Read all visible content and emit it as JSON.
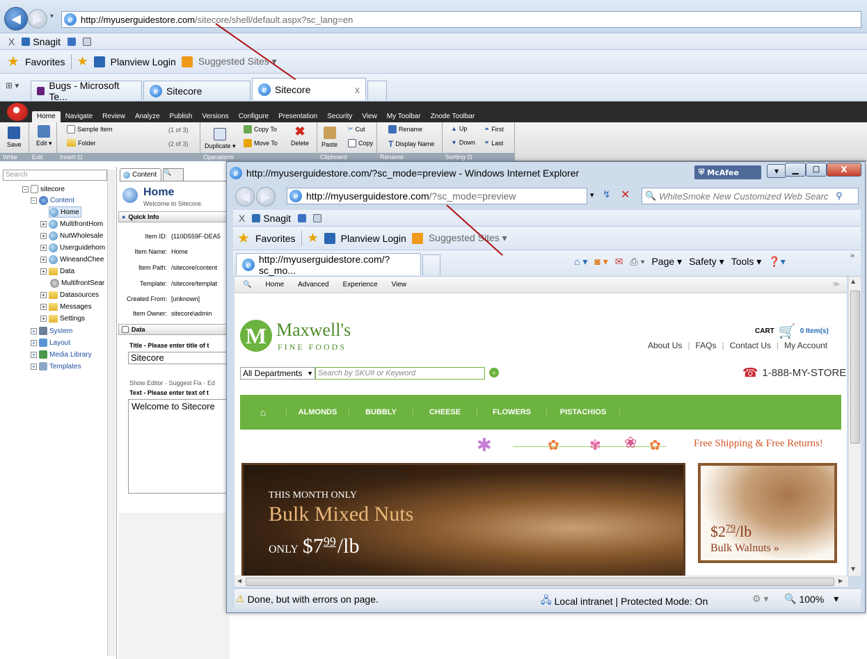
{
  "outer_ie": {
    "url_domain": "http://myuserguidestore.com",
    "url_path": "/sitecore/shell/default.aspx?sc_lang=en",
    "links_bar": {
      "close": "X",
      "snagit": "Snagit"
    },
    "favorites_bar": {
      "favorites": "Favorites",
      "planview": "Planview Login",
      "suggested": "Suggested Sites ▾"
    },
    "tabs": [
      {
        "label": "Bugs - Microsoft Te..."
      },
      {
        "label": "Sitecore"
      },
      {
        "label": "Sitecore",
        "close": "x"
      }
    ]
  },
  "sitecore": {
    "tabs": [
      "Home",
      "Navigate",
      "Review",
      "Analyze",
      "Publish",
      "Versions",
      "Configure",
      "Presentation",
      "Security",
      "View",
      "My Toolbar",
      "Znode Toolbar"
    ],
    "ribbon": {
      "save": "Save",
      "edit": "Edit",
      "edit_dd": "Edit ▾",
      "sample_item": "Sample Item",
      "sample_count": "(1 of 3)",
      "folder": "Folder",
      "folder_count": "(2 of 3)",
      "duplicate": "Duplicate ▾",
      "copy_to": "Copy To",
      "move_to": "Move To",
      "delete": "Delete",
      "paste": "Paste",
      "cut": "Cut",
      "copy": "Copy",
      "rename": "Rename",
      "display_name": "Display Name",
      "up": "Up",
      "down": "Down",
      "first": "First",
      "last": "Last",
      "groups": {
        "write": "Write",
        "edit": "Edit",
        "insert": "Insert ⊡",
        "operations": "Operations",
        "clipboard": "Clipboard",
        "rename": "Rename",
        "sorting": "Sorting ⊡"
      }
    },
    "search_placeholder": "Search",
    "tree": [
      {
        "label": "sitecore"
      },
      {
        "label": "Content"
      },
      {
        "label": "Home"
      },
      {
        "label": "MultifrontHom"
      },
      {
        "label": "NutWholesale"
      },
      {
        "label": "Userguidehom"
      },
      {
        "label": "WineandChee"
      },
      {
        "label": "Data"
      },
      {
        "label": "MultifrontSear"
      },
      {
        "label": "Datasources"
      },
      {
        "label": "Messages"
      },
      {
        "label": "Settings"
      },
      {
        "label": "System"
      },
      {
        "label": "Layout"
      },
      {
        "label": "Media Library"
      },
      {
        "label": "Templates"
      }
    ],
    "content_tab": "Content",
    "item_title": "Home",
    "item_subtitle": "Welcome to Sitecore.",
    "quick_info": "Quick Info",
    "fields": [
      {
        "k": "Item ID:",
        "v": "{110D559F-DEA5"
      },
      {
        "k": "Item Name:",
        "v": "Home"
      },
      {
        "k": "Item Path:",
        "v": "/sitecore/content"
      },
      {
        "k": "Template:",
        "v": "/sitecore/templat"
      },
      {
        "k": "Created From:",
        "v": "[unknown]"
      },
      {
        "k": "Item Owner:",
        "v": "sitecore\\admin"
      }
    ],
    "data_section": "Data",
    "title_label": "Title - Please enter title of t",
    "title_value": "Sitecore",
    "editor_links": "Show Editor · Suggest Fix · Ed",
    "text_label": "Text - Please enter text of t",
    "text_value": "Welcome to Sitecore"
  },
  "inner_ie": {
    "title": "http://myuserguidestore.com/?sc_mode=preview - Windows Internet Explorer",
    "mcafee": "McAfee",
    "url_domain": "http://myuserguidestore.com",
    "url_path": "/?sc_mode=preview",
    "search_placeholder": "WhiteSmoke New Customized Web Searc",
    "links_bar": {
      "close": "X",
      "snagit": "Snagit"
    },
    "favorites_bar": {
      "favorites": "Favorites",
      "planview": "Planview Login",
      "suggested": "Suggested Sites ▾"
    },
    "tab": "http://myuserguidestore.com/?sc_mo...",
    "commands": {
      "page": "Page ▾",
      "safety": "Safety ▾",
      "tools": "Tools ▾",
      "more": "»"
    },
    "status_text": "Done, but with errors on page.",
    "zone": "Local intranet | Protected Mode: On",
    "zoom": "100%"
  },
  "webedit_bar": [
    "Home",
    "Advanced",
    "Experience",
    "View"
  ],
  "site": {
    "logo_letter": "M",
    "brand": "Maxwell's",
    "brand_sub": "FINE FOODS",
    "cart": "CART",
    "cart_items": "0 Item(s)",
    "links": [
      "About Us",
      "FAQs",
      "Contact Us",
      "My Account"
    ],
    "dept": "All Departments",
    "search_placeholder": "Search by SKU# or Keyword",
    "phone": "1-888-MY-STORE",
    "nav": [
      "ALMONDS",
      "BUBBLY",
      "CHEESE",
      "FLOWERS",
      "PISTACHIOS"
    ],
    "shipping": "Free Shipping & Free Returns!",
    "banner1": {
      "kicker": "THIS MONTH ONLY",
      "title": "Bulk Mixed Nuts",
      "only": "ONLY",
      "price": "$7",
      "cents": "99",
      "unit": "/lb"
    },
    "banner2": {
      "price": "$2",
      "cents": "79",
      "unit": "/lb",
      "label": "Bulk Walnuts »"
    }
  },
  "colors": {
    "accent_green": "#6db33f",
    "arrow_red": "#b01010"
  }
}
